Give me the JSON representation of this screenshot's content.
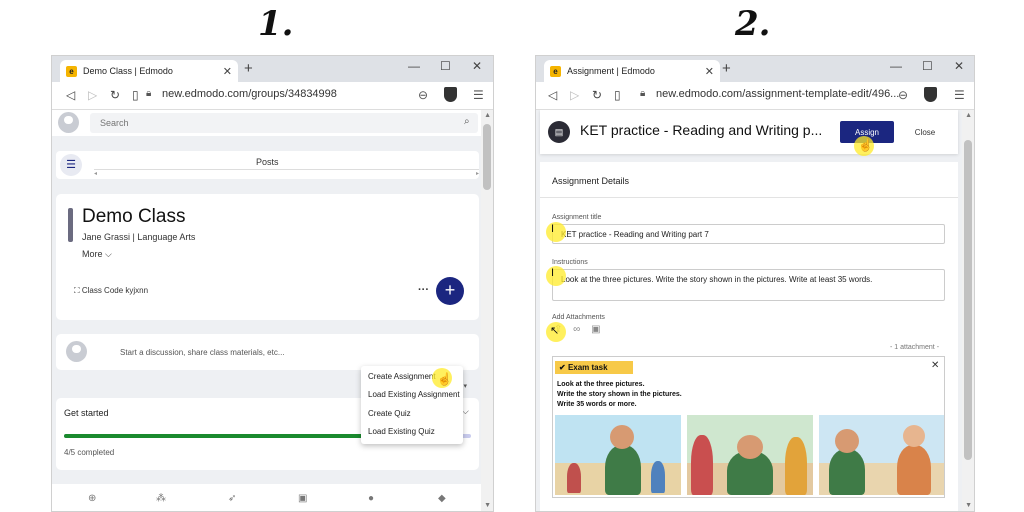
{
  "steps": {
    "one": "1.",
    "two": "2."
  },
  "colors": {
    "brand_navy": "#1b2680",
    "progress_green": "#1a8a2e",
    "highlight_yellow": "#ffeb28",
    "exam_banner": "#f7c948",
    "edmodo_favicon": "#f5b400"
  },
  "window1": {
    "tab_title": "Demo Class | Edmodo",
    "url": "new.edmodo.com/groups/34834998",
    "search_placeholder": "Search",
    "posts_label": "Posts",
    "class_name": "Demo Class",
    "class_sub": "Jane Grassi | Language Arts",
    "more_label": "More ⌵",
    "class_code": "Class Code kyjxnn",
    "fab_label": "+",
    "discuss_placeholder": "Start a discussion, share class materials, etc...",
    "sort_tail": "y ▾",
    "dropdown": {
      "create_assignment": "Create Assignment",
      "load_existing_assignment": "Load Existing Assignment",
      "create_quiz": "Create Quiz",
      "load_existing_quiz": "Load Existing Quiz"
    },
    "get_started_title": "Get started",
    "progress_fraction": 0.8,
    "progress_text": "4/5 completed"
  },
  "window2": {
    "tab_title": "Assignment | Edmodo",
    "url": "new.edmodo.com/assignment-template-edit/496...",
    "assignment_title": "KET practice - Reading and Writing p...",
    "assign_label": "Assign",
    "close_label": "Close",
    "details_heading": "Assignment Details",
    "title_label": "Assignment title",
    "title_value": "KET practice - Reading and Writing part 7",
    "instructions_label": "Instructions",
    "instructions_value": "Look at the three pictures. Write the story shown in the pictures. Write at least 35 words.",
    "attachments_label": "Add Attachments",
    "attachment_count": "- 1 attachment -",
    "exam_banner": "Exam task",
    "exam_line1": "Look at the three pictures.",
    "exam_line2": "Write the story shown in the pictures.",
    "exam_line3": "Write 35 words or more."
  },
  "icons": [
    "back-icon",
    "forward-icon",
    "reload-icon",
    "bookmark-icon",
    "lock-icon",
    "zoom-icon",
    "shield-icon",
    "menu-icon",
    "search-icon",
    "hand-cursor-icon",
    "text-cursor-icon",
    "link-icon",
    "file-icon"
  ]
}
